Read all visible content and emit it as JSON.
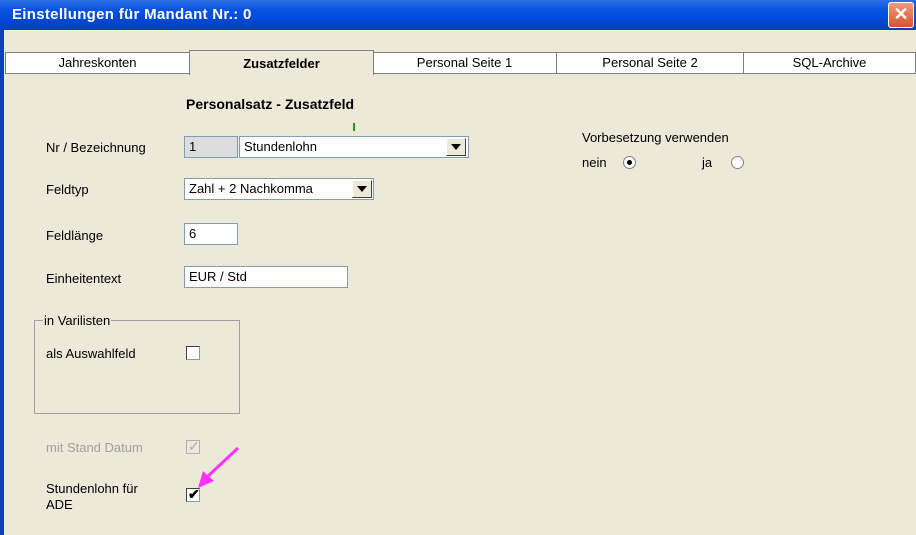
{
  "window": {
    "title": "Einstellungen für Mandant Nr.: 0",
    "close_symbol": "✕"
  },
  "tabs": [
    {
      "label": "Jahreskonten"
    },
    {
      "label": "Zusatzfelder"
    },
    {
      "label": "Personal Seite 1"
    },
    {
      "label": "Personal Seite 2"
    },
    {
      "label": "SQL-Archive"
    }
  ],
  "section_title": "Personalsatz - Zusatzfeld",
  "form": {
    "nr_label": "Nr / Bezeichnung",
    "nr_value": "1",
    "bezeichnung_value": "Stundenlohn",
    "feldtyp_label": "Feldtyp",
    "feldtyp_value": "Zahl + 2 Nachkomma",
    "feldlaenge_label": "Feldlänge",
    "feldlaenge_value": "6",
    "einheitentext_label": "Einheitentext",
    "einheitentext_value": "EUR / Std"
  },
  "varilisten": {
    "group_title": "in Varilisten",
    "auswahlfeld_label": "als Auswahlfeld",
    "auswahlfeld_checked": false
  },
  "mit_stand_datum": {
    "label": "mit Stand Datum",
    "checked": true,
    "enabled": false
  },
  "stundenlohn_ade": {
    "label_line1": "Stundenlohn für",
    "label_line2": "ADE",
    "checked": true,
    "checkmark": "✔"
  },
  "vorbesetzung": {
    "label": "Vorbesetzung verwenden",
    "options": [
      {
        "label": "nein",
        "selected": true
      },
      {
        "label": "ja",
        "selected": false
      }
    ]
  },
  "colors": {
    "titlebar": "#0a54e2",
    "annotation_arrow": "#ff33ff",
    "dialog_bg": "#ece9d8"
  }
}
